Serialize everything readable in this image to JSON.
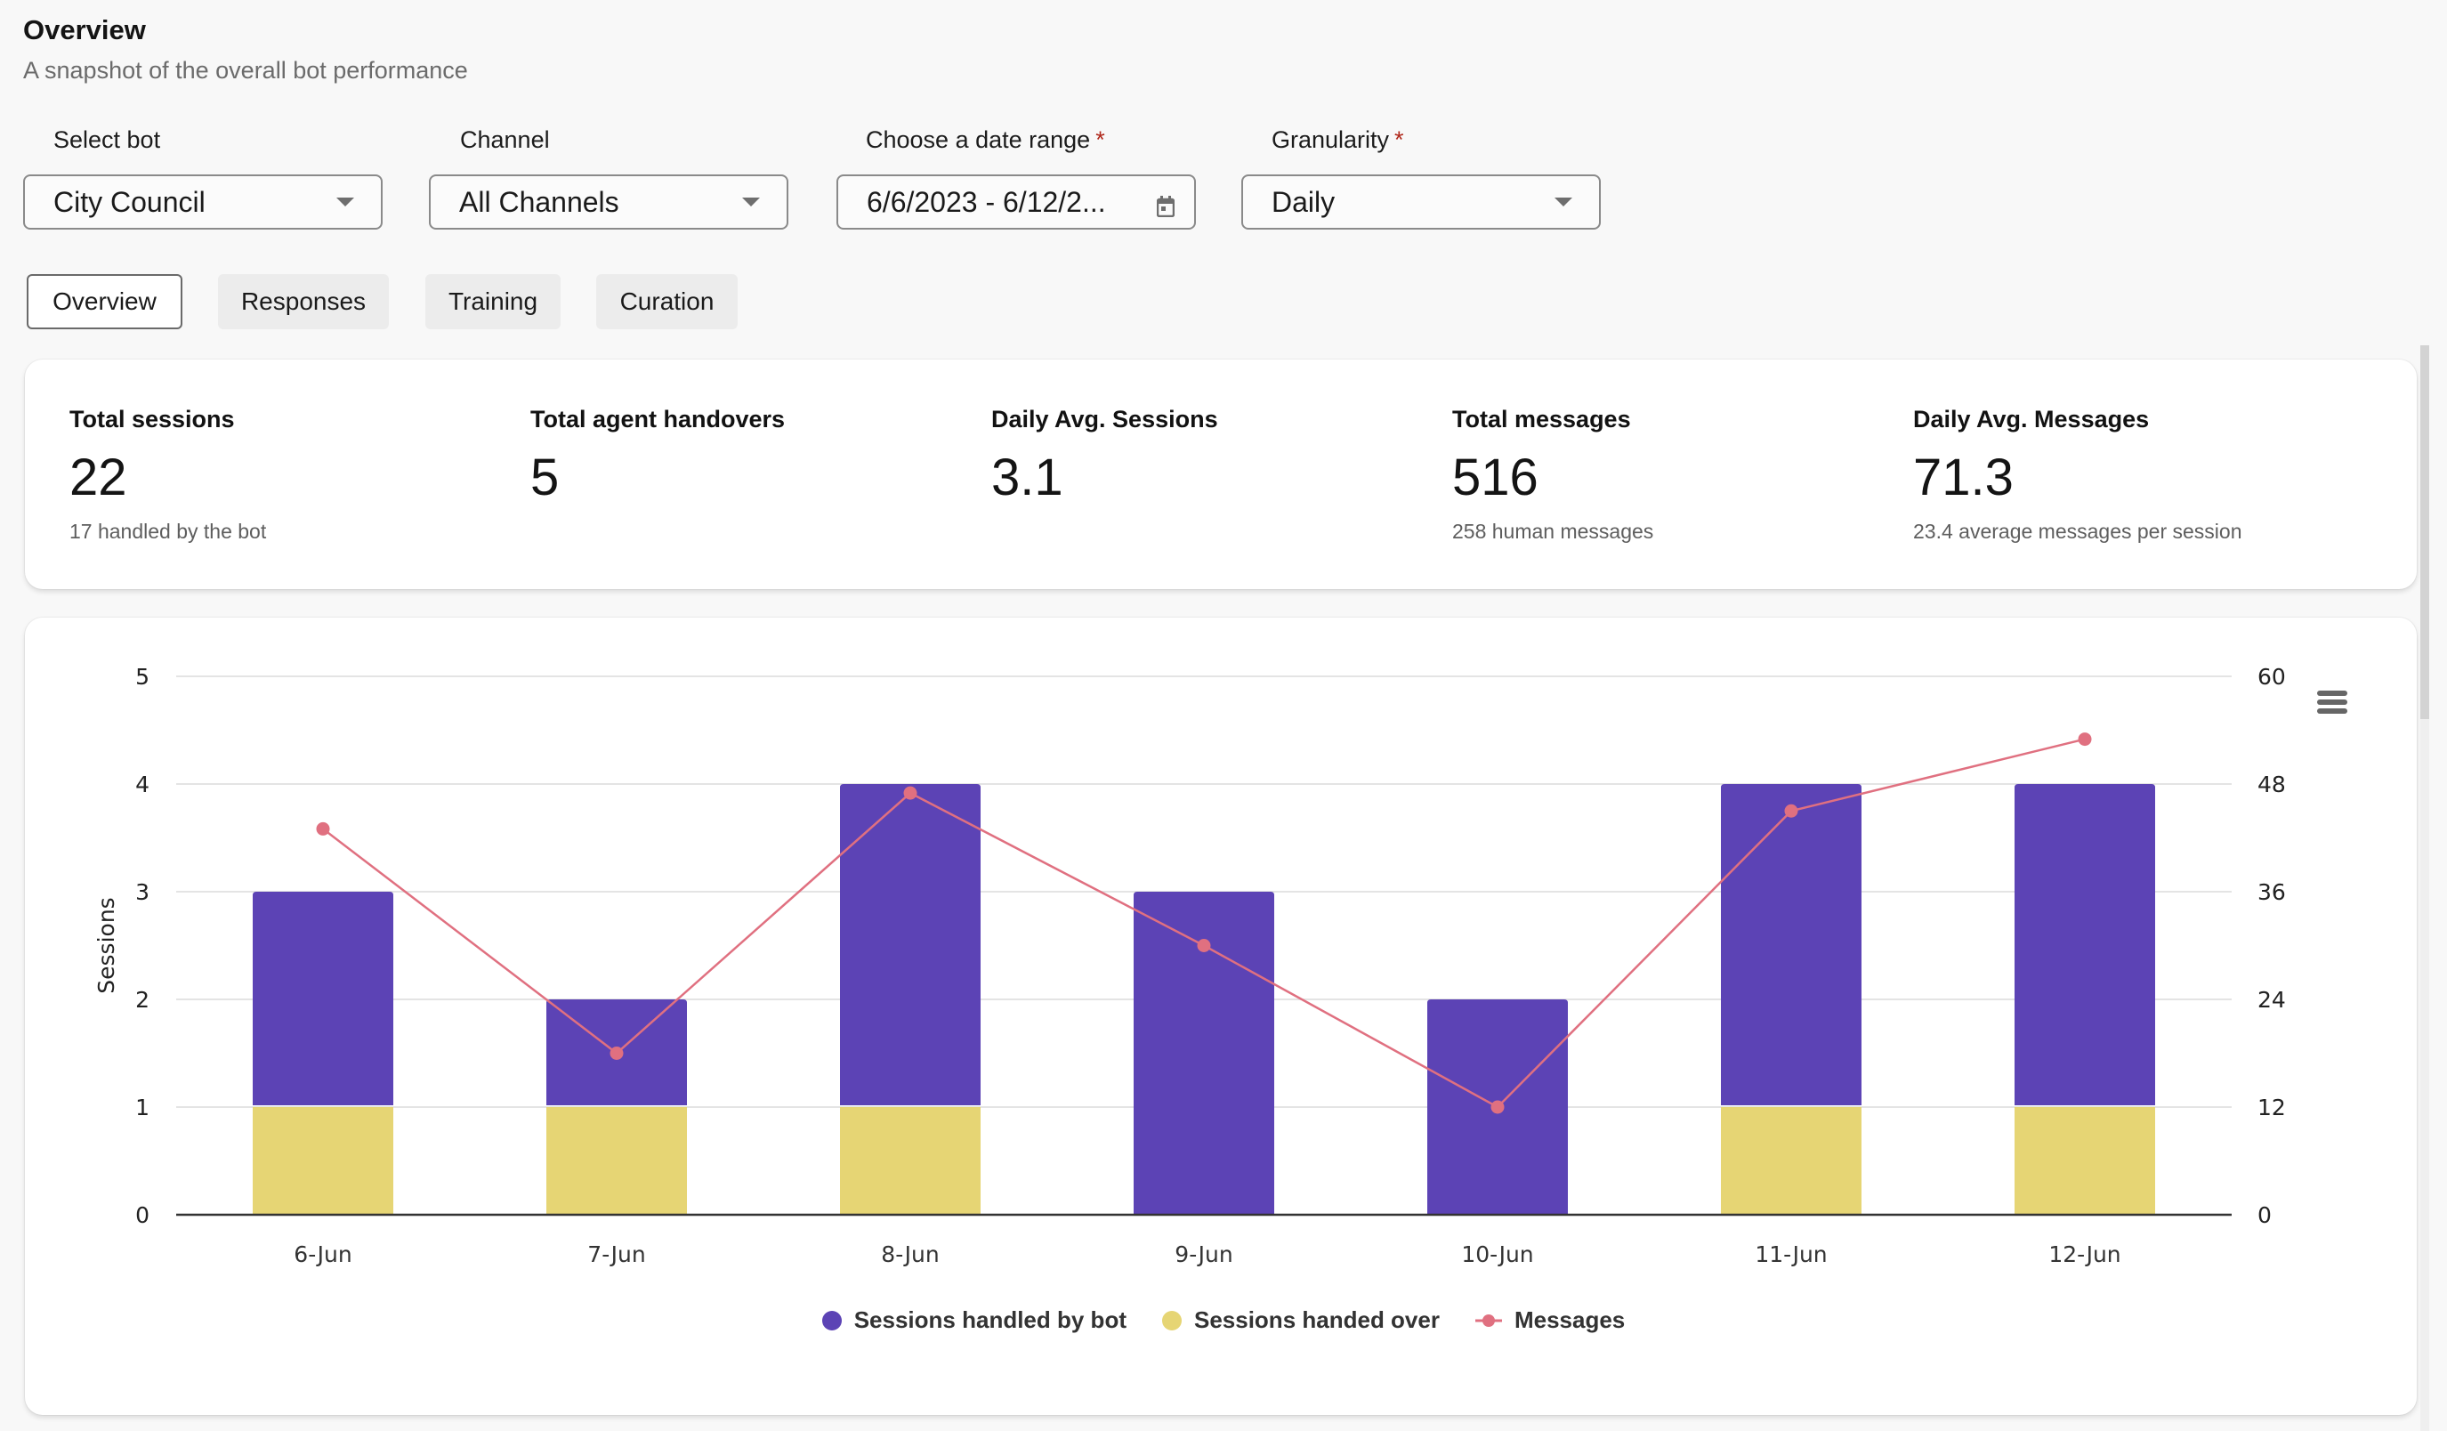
{
  "header": {
    "title": "Overview",
    "subtitle": "A snapshot of the overall bot performance"
  },
  "filters": {
    "bot": {
      "label": "Select bot",
      "value": "City Council",
      "required": false
    },
    "channel": {
      "label": "Channel",
      "value": "All Channels",
      "required": false
    },
    "date_range": {
      "label": "Choose a date range",
      "value": "6/6/2023 - 6/12/2...",
      "required_mark": "*"
    },
    "granularity": {
      "label": "Granularity",
      "value": "Daily",
      "required_mark": "*"
    }
  },
  "tabs": [
    {
      "label": "Overview",
      "active": true
    },
    {
      "label": "Responses",
      "active": false
    },
    {
      "label": "Training",
      "active": false
    },
    {
      "label": "Curation",
      "active": false
    }
  ],
  "stats": [
    {
      "label": "Total sessions",
      "value": "22",
      "sub": "17 handled by the bot"
    },
    {
      "label": "Total agent handovers",
      "value": "5",
      "sub": ""
    },
    {
      "label": "Daily Avg. Sessions",
      "value": "3.1",
      "sub": ""
    },
    {
      "label": "Total messages",
      "value": "516",
      "sub": "258 human messages"
    },
    {
      "label": "Daily Avg. Messages",
      "value": "71.3",
      "sub": "23.4 average messages per session"
    }
  ],
  "colors": {
    "bot": "#5c43b5",
    "handover": "#e6d574",
    "messages": "#e07080"
  },
  "chart_data": {
    "type": "bar",
    "stacked": true,
    "title": "",
    "categories": [
      "6-Jun",
      "7-Jun",
      "8-Jun",
      "9-Jun",
      "10-Jun",
      "11-Jun",
      "12-Jun"
    ],
    "series": [
      {
        "name": "Sessions handed over",
        "type": "bar",
        "axis": "left",
        "values": [
          1,
          1,
          1,
          0,
          0,
          1,
          1
        ]
      },
      {
        "name": "Sessions handled by bot",
        "type": "bar",
        "axis": "left",
        "values": [
          2,
          1,
          3,
          3,
          2,
          3,
          3
        ]
      },
      {
        "name": "Messages",
        "type": "line",
        "axis": "right",
        "values": [
          43,
          18,
          47,
          30,
          12,
          45,
          53
        ]
      }
    ],
    "legend_order": [
      "Sessions handled by bot",
      "Sessions handed over",
      "Messages"
    ],
    "legend_position": "bottom-center",
    "ylabel": "Sessions",
    "y_left": {
      "range": [
        0,
        5
      ],
      "ticks": [
        "0",
        "1",
        "2",
        "3",
        "4",
        "5"
      ]
    },
    "y_right": {
      "range": [
        0,
        60
      ],
      "ticks": [
        "0",
        "12",
        "24",
        "36",
        "48",
        "60"
      ]
    },
    "grid": true
  }
}
